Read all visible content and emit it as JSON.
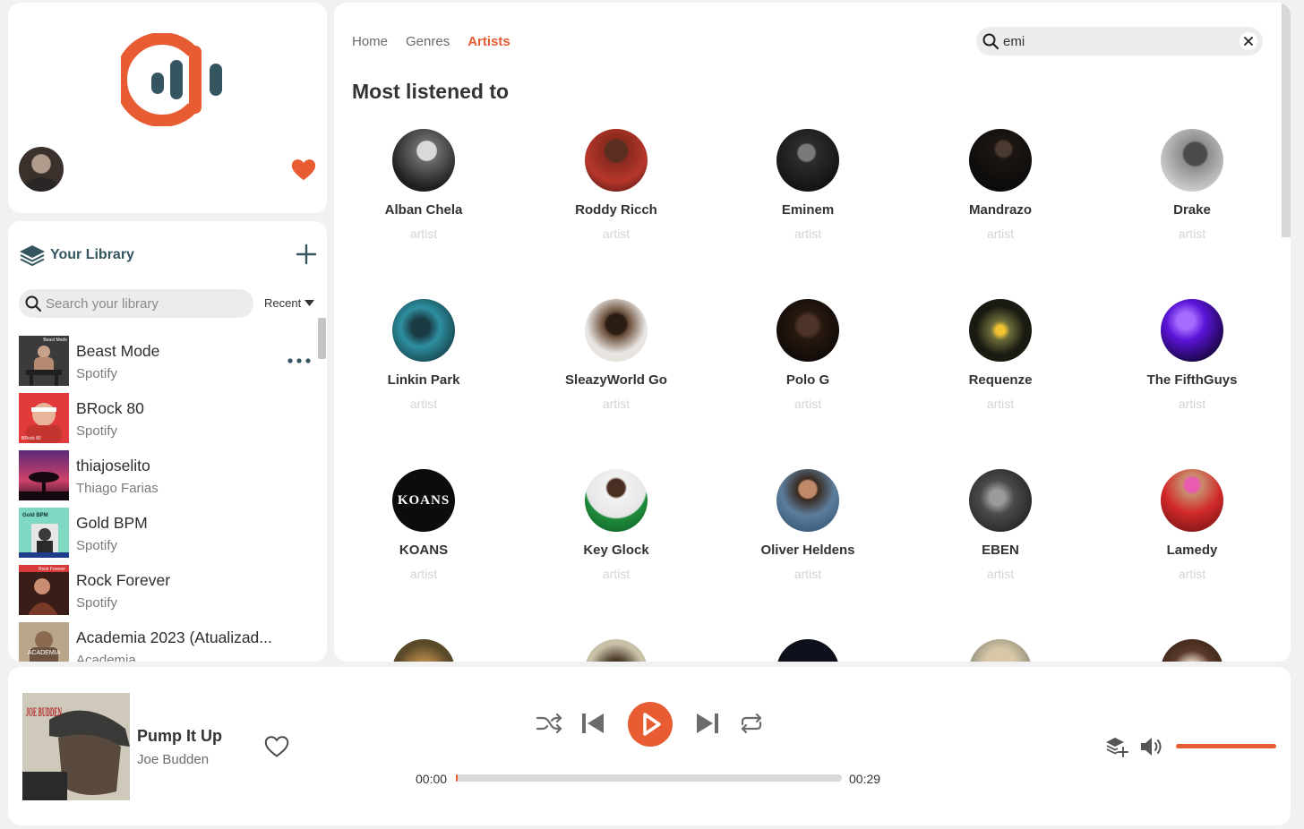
{
  "colors": {
    "accent": "#e85c33",
    "teal": "#355561",
    "muted_text": "#d4d4d4"
  },
  "logo": {
    "icon": "equalizer-logo-icon"
  },
  "library": {
    "title": "Your Library",
    "search_placeholder": "Search your library",
    "sort_label": "Recent",
    "items": [
      {
        "name": "Beast Mode",
        "subtitle": "Spotify"
      },
      {
        "name": "BRock 80",
        "subtitle": "Spotify"
      },
      {
        "name": "thiajoselito",
        "subtitle": "Thiago Farias"
      },
      {
        "name": "Gold BPM",
        "subtitle": "Spotify"
      },
      {
        "name": "Rock Forever",
        "subtitle": "Spotify"
      },
      {
        "name": "Academia 2023 (Atualizad...",
        "subtitle": "Academia"
      }
    ],
    "cover_captions": {
      "beast": "Beast Mode",
      "brock": "BRock 80",
      "gold": "Gold BPM",
      "rock": "Rock Forever",
      "academia": "ACADEMIA"
    }
  },
  "nav": {
    "home": "Home",
    "genres": "Genres",
    "artists": "Artists"
  },
  "search": {
    "value": "emi"
  },
  "section_title": "Most listened to",
  "artists": [
    {
      "name": "Alban Chela",
      "type": "artist"
    },
    {
      "name": "Roddy Ricch",
      "type": "artist"
    },
    {
      "name": "Eminem",
      "type": "artist"
    },
    {
      "name": "Mandrazo",
      "type": "artist"
    },
    {
      "name": "Drake",
      "type": "artist"
    },
    {
      "name": "Linkin Park",
      "type": "artist"
    },
    {
      "name": "SleazyWorld Go",
      "type": "artist"
    },
    {
      "name": "Polo G",
      "type": "artist"
    },
    {
      "name": "Requenze",
      "type": "artist"
    },
    {
      "name": "The FifthGuys",
      "type": "artist"
    },
    {
      "name": "KOANS",
      "type": "artist"
    },
    {
      "name": "Key Glock",
      "type": "artist"
    },
    {
      "name": "Oliver Heldens",
      "type": "artist"
    },
    {
      "name": "EBEN",
      "type": "artist"
    },
    {
      "name": "Lamedy",
      "type": "artist"
    }
  ],
  "koans_logo": "KOANS",
  "player": {
    "title": "Pump It Up",
    "artist": "Joe Budden",
    "cover_text": "JOE BUDDEN",
    "time_current": "00:00",
    "time_total": "00:29",
    "progress_fraction": 0.0,
    "volume_fraction": 1.0
  }
}
